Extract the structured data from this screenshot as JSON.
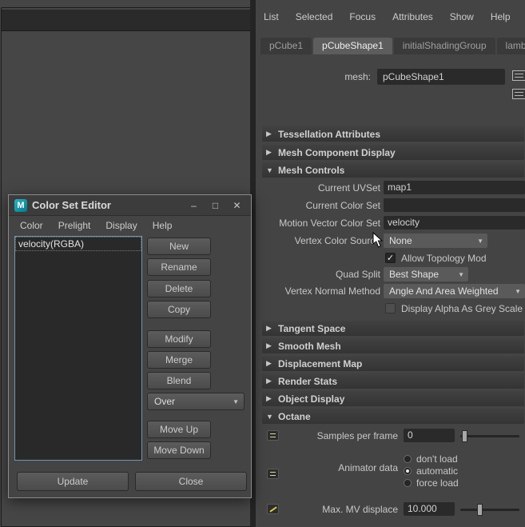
{
  "colors": {
    "panel_bg": "#444444",
    "field_bg": "#2a2a2a",
    "focus_border_blue": "#6f97b2",
    "maya_icon_teal": "#0b9aaa"
  },
  "icons": {
    "chevron_down": "▼",
    "check": "✓"
  },
  "attribute_editor": {
    "menu": {
      "items": [
        "List",
        "Selected",
        "Focus",
        "Attributes",
        "Show",
        "Help"
      ]
    },
    "tabs": [
      {
        "label": "pCube1",
        "active": false
      },
      {
        "label": "pCubeShape1",
        "active": true
      },
      {
        "label": "initialShadingGroup",
        "active": false
      },
      {
        "label": "lambe",
        "active": false
      }
    ],
    "mesh": {
      "label": "mesh:",
      "value": "pCubeShape1"
    },
    "sections": [
      {
        "label": "Tessellation Attributes",
        "arrow": "▶",
        "expanded": false
      },
      {
        "label": "Mesh Component Display",
        "arrow": "▶",
        "expanded": false
      },
      {
        "label": "Mesh Controls",
        "arrow": "▼",
        "expanded": true
      },
      {
        "label": "Tangent Space",
        "arrow": "▶",
        "expanded": false
      },
      {
        "label": "Smooth Mesh",
        "arrow": "▶",
        "expanded": false
      },
      {
        "label": "Displacement Map",
        "arrow": "▶",
        "expanded": false
      },
      {
        "label": "Render Stats",
        "arrow": "▶",
        "expanded": false
      },
      {
        "label": "Object Display",
        "arrow": "▶",
        "expanded": false
      },
      {
        "label": "Octane",
        "arrow": "▼",
        "expanded": true
      }
    ],
    "mesh_controls": {
      "current_uvset": {
        "label": "Current UVSet",
        "value": "map1"
      },
      "current_color_set": {
        "label": "Current Color Set",
        "value": ""
      },
      "motion_vector_color_set": {
        "label": "Motion Vector Color Set",
        "value": "velocity"
      },
      "vertex_color_source": {
        "label": "Vertex Color Source",
        "value": "None"
      },
      "allow_topology_mod": {
        "label": "Allow Topology Mod",
        "checked": true
      },
      "quad_split": {
        "label": "Quad Split",
        "value": "Best Shape"
      },
      "vertex_normal_method": {
        "label": "Vertex Normal Method",
        "value": "Angle And Area Weighted"
      },
      "display_alpha_as_grey_scale": {
        "label": "Display Alpha As Grey Scale",
        "checked": false
      }
    },
    "octane": {
      "samples_per_frame": {
        "label": "Samples per frame",
        "value": "0"
      },
      "animator_data": {
        "label": "Animator data",
        "options": [
          "don't load",
          "automatic",
          "force load"
        ],
        "selected": "automatic"
      },
      "max_mv_displace": {
        "label": "Max. MV displace",
        "value": "10.000"
      }
    }
  },
  "color_set_editor": {
    "title": "Color Set Editor",
    "icon_letter": "M",
    "window_controls": {
      "minimize": "–",
      "maximize": "□",
      "close": "✕"
    },
    "menu": [
      "Color",
      "Prelight",
      "Display",
      "Help"
    ],
    "list_items": [
      "velocity(RGBA)"
    ],
    "buttons": {
      "new": "New",
      "rename": "Rename",
      "delete": "Delete",
      "copy": "Copy",
      "modify": "Modify",
      "merge": "Merge",
      "blend": "Blend",
      "move_up": "Move Up",
      "move_down": "Move Down",
      "update": "Update",
      "close": "Close"
    },
    "blend_mode": "Over"
  }
}
